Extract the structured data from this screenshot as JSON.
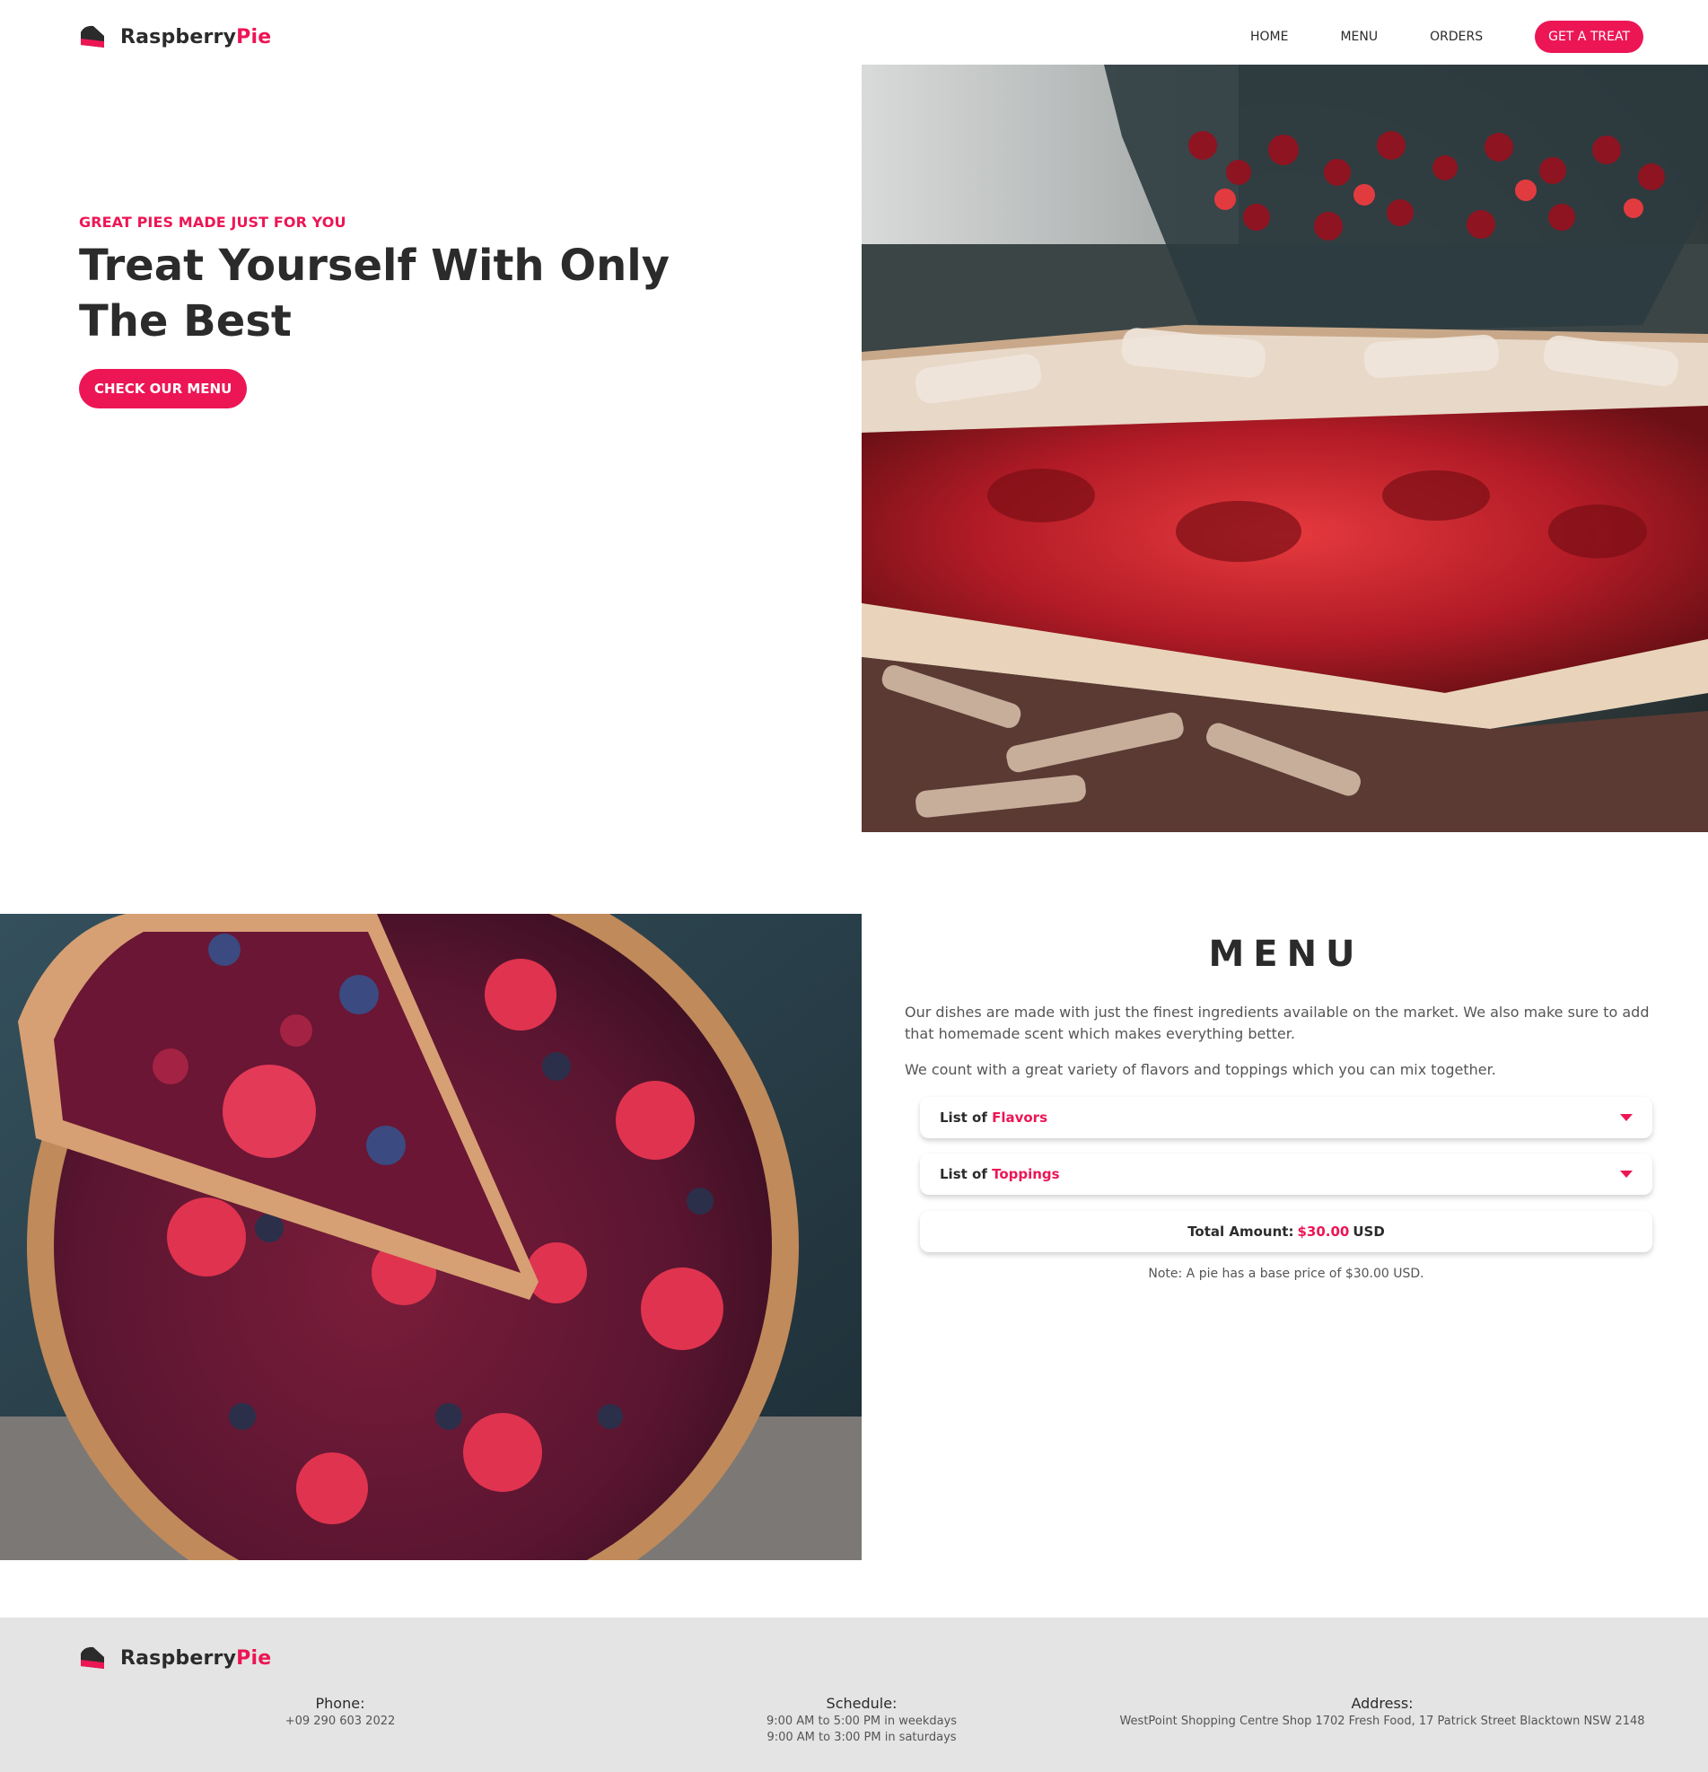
{
  "brand": {
    "name_main": "Raspberry",
    "name_accent": "Pie",
    "logo_icon": "pie-slice-icon"
  },
  "nav": {
    "home": "HOME",
    "menu": "MENU",
    "orders": "ORDERS",
    "cta": "GET A TREAT"
  },
  "hero": {
    "eyebrow": "GREAT PIES MADE JUST FOR YOU",
    "title": "Treat Yourself With Only The Best",
    "button": "CHECK OUR MENU",
    "image": "cherry-lattice-pie-photo"
  },
  "menu": {
    "image": "berry-pie-slice-photo",
    "heading": "MENU",
    "desc1": "Our dishes are made with just the finest ingredients available on the market. We also make sure to add that homemade scent which makes everything better.",
    "desc2": "We count with a great variety of flavors and toppings which you can mix together.",
    "flavors": {
      "prefix": "List of",
      "accent": "Flavors"
    },
    "toppings": {
      "prefix": "List of",
      "accent": "Toppings"
    },
    "total": {
      "label": "Total Amount:",
      "amount": "$30.00",
      "currency": "USD"
    },
    "note": "Note: A pie has a base price of $30.00 USD."
  },
  "footer": {
    "phone": {
      "title": "Phone:",
      "value": "+09 290 603 2022"
    },
    "schedule": {
      "title": "Schedule:",
      "line1": "9:00 AM to 5:00 PM in weekdays",
      "line2": "9:00 AM to 3:00 PM in saturdays"
    },
    "address": {
      "title": "Address:",
      "value": "WestPoint Shopping Centre Shop 1702 Fresh Food, 17 Patrick Street Blacktown NSW 2148"
    }
  },
  "colors": {
    "accent": "#ec1655",
    "text": "#2b2b2b",
    "footer_bg": "#e4e4e4"
  }
}
